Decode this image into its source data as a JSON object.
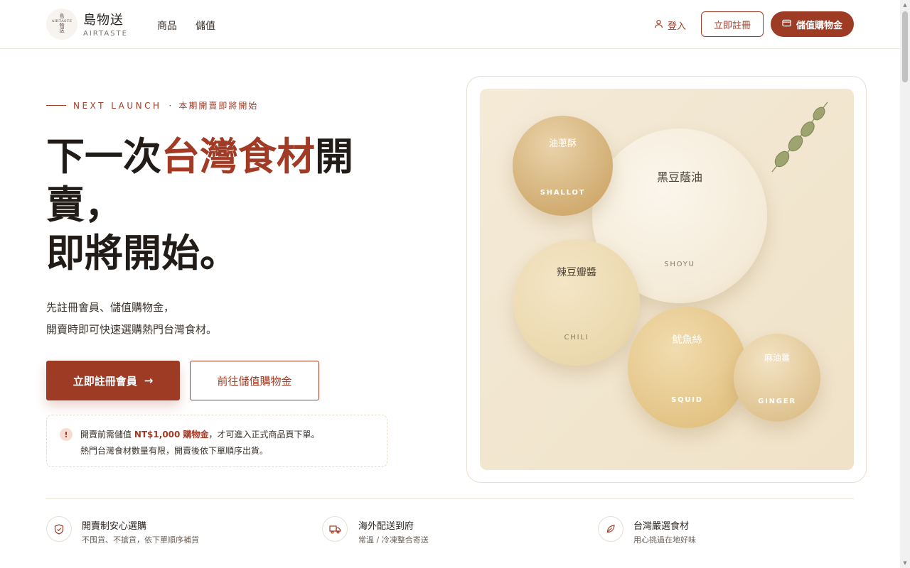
{
  "header": {
    "logo_seal_top": "島",
    "logo_seal_mid": "AIRTASTE",
    "logo_seal_bottom_1": "物",
    "logo_seal_bottom_2": "送",
    "brand_cn": "島物送",
    "brand_en": "AIRTASTE",
    "nav": [
      "商品",
      "儲值"
    ],
    "login_label": "登入",
    "register_label": "立即註冊",
    "topup_label": "儲值購物金"
  },
  "hero": {
    "eyebrow_en": "NEXT LAUNCH",
    "eyebrow_dot": "·",
    "eyebrow_cn": "本期開賣即將開始",
    "headline_1": "下一次",
    "headline_accent": "台灣食材",
    "headline_2": "開賣，",
    "headline_3": "即將開始。",
    "lead_1": "先註冊會員、儲值購物金，",
    "lead_2": "開賣時即可快速選購熱門台灣食材。",
    "cta_primary": "立即註冊會員",
    "cta_primary_arrow": "→",
    "cta_secondary": "前往儲值購物金",
    "notice_icon": "!",
    "notice_pre": "開賣前需儲值 ",
    "notice_highlight": "NT$1,000 購物金",
    "notice_post": "，才可進入正式商品頁下單。",
    "notice_line2": "熱門台灣食材數量有限，開賣後依下單順序出貨。"
  },
  "visual": {
    "bubbles": [
      {
        "cn": "油蔥酥",
        "en": "SHALLOT"
      },
      {
        "cn": "黑豆蔭油",
        "en": "SHOYU"
      },
      {
        "cn": "辣豆瓣醬",
        "en": "CHILI"
      },
      {
        "cn": "魷魚絲",
        "en": "SQUID"
      },
      {
        "cn": "麻油薑",
        "en": "GINGER"
      }
    ]
  },
  "features": [
    {
      "icon": "shield-icon",
      "title": "開賣制安心選購",
      "sub": "不囤貨、不搶貨，依下單順序補貨"
    },
    {
      "icon": "truck-icon",
      "title": "海外配送到府",
      "sub": "常溫 / 冷凍整合寄送"
    },
    {
      "icon": "leaf-icon",
      "title": "台灣嚴選食材",
      "sub": "用心挑過在地好味"
    }
  ],
  "colors": {
    "brand": "#9e3b24",
    "accent_text": "#a13b26",
    "canvas": "#f4ead7"
  }
}
